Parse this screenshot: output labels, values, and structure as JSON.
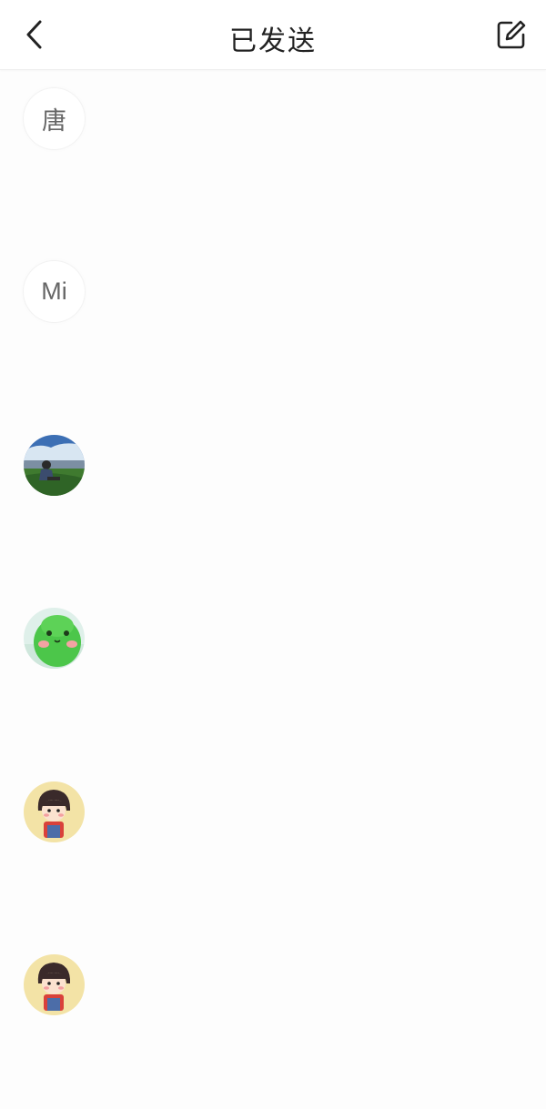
{
  "header": {
    "title": "已发送",
    "back_icon": "chevron-left-icon",
    "compose_icon": "edit-compose-icon"
  },
  "contacts": [
    {
      "avatar_type": "text",
      "avatar_text": "唐"
    },
    {
      "avatar_type": "text",
      "avatar_text": "Mi"
    },
    {
      "avatar_type": "image",
      "avatar_icon": "landscape-photo-avatar"
    },
    {
      "avatar_type": "image",
      "avatar_icon": "green-bird-avatar"
    },
    {
      "avatar_type": "image",
      "avatar_icon": "cartoon-girl-avatar"
    },
    {
      "avatar_type": "image",
      "avatar_icon": "cartoon-girl-avatar"
    }
  ],
  "colors": {
    "background": "#fdfdfd",
    "header_bg": "#ffffff",
    "title_text": "#222222",
    "avatar_text": "#666666"
  }
}
